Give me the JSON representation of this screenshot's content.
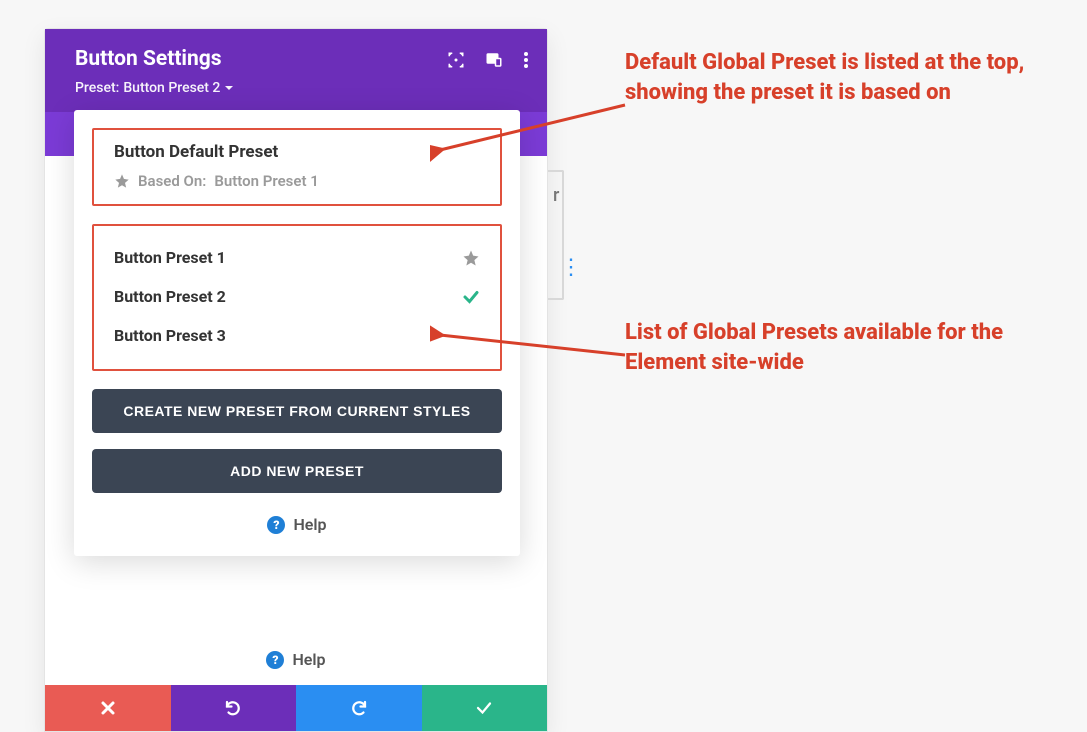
{
  "header": {
    "title": "Button Settings",
    "subtitle_prefix": "Preset:",
    "subtitle_preset": "Button Preset 2"
  },
  "dropdown": {
    "default_preset_title": "Button Default Preset",
    "based_on_label": "Based On:",
    "based_on_preset": "Button Preset 1",
    "presets": [
      {
        "name": "Button Preset 1",
        "starred": true,
        "checked": false
      },
      {
        "name": "Button Preset 2",
        "starred": false,
        "checked": true
      },
      {
        "name": "Button Preset 3",
        "starred": false,
        "checked": false
      }
    ],
    "create_button": "CREATE NEW PRESET FROM CURRENT STYLES",
    "add_button": "ADD NEW PRESET",
    "help_label": "Help"
  },
  "panel_help": "Help",
  "annotations": {
    "top": "Default Global Preset is listed at the top, showing the preset it is based on",
    "bottom": "List of Global Presets available for the Element site-wide"
  },
  "colors": {
    "header": "#6c2eb9",
    "callout": "#e0513e",
    "annotation": "#d7402a",
    "close": "#e95b54",
    "undo": "#6c2eb9",
    "redo": "#2a8ef2",
    "confirm": "#2ab58a"
  },
  "icons": {
    "target": "target-icon",
    "responsive": "responsive-icon",
    "menu": "menu-dots-icon",
    "caret": "caret-down-icon",
    "star": "star-icon",
    "check": "check-icon",
    "help": "help-icon",
    "close": "close-icon",
    "undo": "undo-icon",
    "redo": "redo-icon",
    "confirm": "confirm-check-icon"
  }
}
